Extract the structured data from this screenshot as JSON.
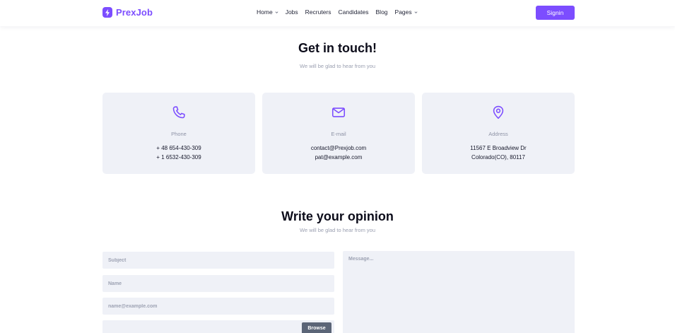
{
  "brand": {
    "name": "PrexJob",
    "color": "#7c4dff"
  },
  "nav": {
    "items": [
      {
        "label": "Home",
        "dropdown": true
      },
      {
        "label": "Jobs",
        "dropdown": false
      },
      {
        "label": "Recruters",
        "dropdown": false
      },
      {
        "label": "Candidates",
        "dropdown": false
      },
      {
        "label": "Blog",
        "dropdown": false
      },
      {
        "label": "Pages",
        "dropdown": true
      }
    ],
    "signin_label": "Signin"
  },
  "contact": {
    "title": "Get in touch!",
    "subtitle": "We will be glad to hear from you",
    "cards": [
      {
        "icon": "phone-icon",
        "label": "Phone",
        "lines": [
          "+ 48 654-430-309",
          "+ 1 6532-430-309"
        ]
      },
      {
        "icon": "mail-icon",
        "label": "E-mail",
        "lines": [
          "contact@Prexjob.com",
          "pat@example.com"
        ]
      },
      {
        "icon": "location-pin-icon",
        "label": "Address",
        "lines": [
          "11567 E Broadview Dr",
          "Colorado(CO), 80117"
        ]
      }
    ]
  },
  "opinion": {
    "title": "Write your opinion",
    "subtitle": "We will be glad to hear from you",
    "subject_placeholder": "Subject",
    "name_placeholder": "Name",
    "email_placeholder": "name@example.com",
    "message_placeholder": "Message...",
    "browse_label": "Browse"
  }
}
